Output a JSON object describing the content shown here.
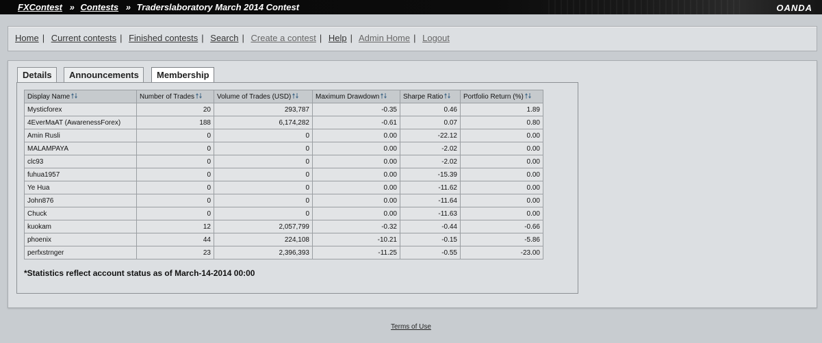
{
  "header": {
    "crumbs": [
      "FXContest",
      "Contests"
    ],
    "separator": "»",
    "current": "Traderslaboratory March 2014 Contest",
    "brand": "OANDA"
  },
  "nav": {
    "items": [
      {
        "label": "Home"
      },
      {
        "label": "Current contests"
      },
      {
        "label": "Finished contests"
      },
      {
        "label": "Search"
      },
      {
        "label": "Create a contest"
      },
      {
        "label": "Help"
      },
      {
        "label": "Admin Home"
      },
      {
        "label": "Logout"
      }
    ],
    "sep": "|"
  },
  "tabs": [
    {
      "label": "Details"
    },
    {
      "label": "Announcements"
    },
    {
      "label": "Membership"
    }
  ],
  "table": {
    "columns": [
      "Display Name",
      "Number of Trades",
      "Volume of Trades (USD)",
      "Maximum Drawdown",
      "Sharpe Ratio",
      "Portfolio Return (%)"
    ],
    "rows": [
      [
        "Mysticforex",
        "20",
        "293,787",
        "-0.35",
        "0.46",
        "1.89"
      ],
      [
        "4EverMaAT (AwarenessForex)",
        "188",
        "6,174,282",
        "-0.61",
        "0.07",
        "0.80"
      ],
      [
        "Amin Rusli",
        "0",
        "0",
        "0.00",
        "-22.12",
        "0.00"
      ],
      [
        "MALAMPAYA",
        "0",
        "0",
        "0.00",
        "-2.02",
        "0.00"
      ],
      [
        "clc93",
        "0",
        "0",
        "0.00",
        "-2.02",
        "0.00"
      ],
      [
        "fuhua1957",
        "0",
        "0",
        "0.00",
        "-15.39",
        "0.00"
      ],
      [
        "Ye Hua",
        "0",
        "0",
        "0.00",
        "-11.62",
        "0.00"
      ],
      [
        "John876",
        "0",
        "0",
        "0.00",
        "-11.64",
        "0.00"
      ],
      [
        "Chuck",
        "0",
        "0",
        "0.00",
        "-11.63",
        "0.00"
      ],
      [
        "kuokam",
        "12",
        "2,057,799",
        "-0.32",
        "-0.44",
        "-0.66"
      ],
      [
        "phoenix",
        "44",
        "224,108",
        "-10.21",
        "-0.15",
        "-5.86"
      ],
      [
        "perfxstrnger",
        "23",
        "2,396,393",
        "-11.25",
        "-0.55",
        "-23.00"
      ]
    ]
  },
  "footnote": "*Statistics reflect account status as of March-14-2014 00:00",
  "footer": {
    "terms": "Terms of Use"
  },
  "colors": {
    "accent_sort": "#4a6e8c"
  }
}
